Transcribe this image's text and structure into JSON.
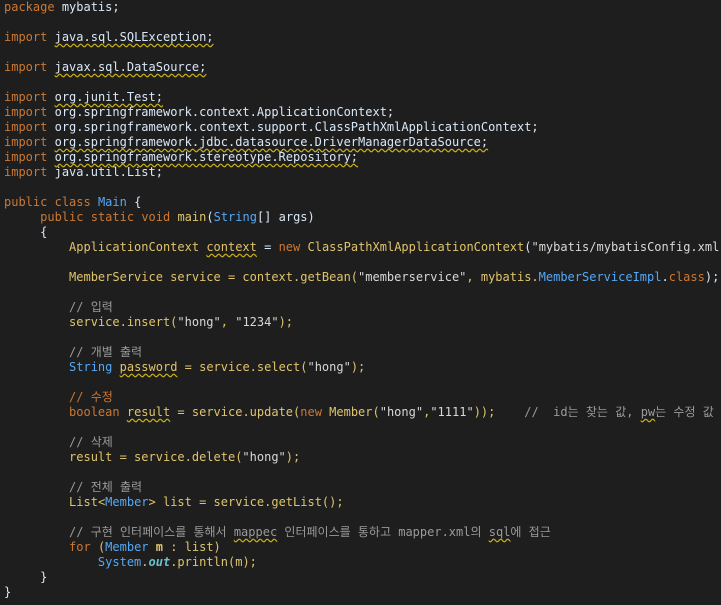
{
  "code": {
    "package_kw": "package",
    "package_name": "mybatis;",
    "import_kw": "import",
    "imports": [
      "java.sql.SQLException;",
      "javax.sql.DataSource;",
      "org.junit.Test;",
      "org.springframework.context.ApplicationContext;",
      "org.springframework.context.support.ClassPathXmlApplicationContext;",
      "org.springframework.jdbc.datasource.DriverManagerDataSource;",
      "org.springframework.stereotype.Repository;",
      "java.util.List;"
    ],
    "class_public": "public",
    "class_kw": "class",
    "class_name": "Main",
    "open_brace": "{",
    "close_brace": "}",
    "method_public": "public",
    "method_static": "static",
    "method_void": "void",
    "method_name": "main",
    "method_params_open": "(",
    "method_param_type": "String",
    "method_params_rest": "[] args)",
    "lines": {
      "ctx_type": "ApplicationContext",
      "ctx_var": "context",
      "ctx_eq": " = ",
      "ctx_new": "new",
      "ctx_cls": "ClassPathXmlApplicationContext",
      "ctx_arg_open": "(",
      "ctx_str": "\"mybatis/mybatisConfig.xml\"",
      "ctx_arg_close": ");",
      "svc_type": "MemberService",
      "svc_decl": " service = context.getBean(",
      "svc_str": "\"memberservice\"",
      "svc_mid": ", mybatis.",
      "svc_impl": "MemberServiceImpl",
      "svc_dot": ".",
      "svc_class": "class",
      "svc_end": ");",
      "c_insert": "// 입력",
      "insert_pre": "service.insert(",
      "insert_s1": "\"hong\"",
      "insert_comma": ", ",
      "insert_s2": "\"1234\"",
      "insert_end": ");",
      "c_select": "// 개별 출력",
      "sel_type": "String",
      "sel_var": "password",
      "sel_mid": " = service.select(",
      "sel_str": "\"hong\"",
      "sel_end": ");",
      "c_update": "// 수정",
      "upd_type": "boolean",
      "upd_var": "result",
      "upd_mid": " = service.update(",
      "upd_new": "new",
      "upd_cls": " Member(",
      "upd_s1": "\"hong\"",
      "upd_comma": ",",
      "upd_s2": "\"1111\"",
      "upd_end": "));",
      "upd_cmt_a": "//  id는 찾는 값, ",
      "upd_cmt_pw": "pw",
      "upd_cmt_b": "는 수정 값",
      "c_delete": "// 삭제",
      "del_pre": "result = service.delete(",
      "del_str": "\"hong\"",
      "del_end": ");",
      "c_list": "// 전체 출력",
      "list_type": "List",
      "list_lt": "<",
      "list_gen": "Member",
      "list_rest": "> list = service.getList();",
      "c_mapper_a": "// 구현 인터페이스를 통해서 ",
      "c_mapper_w1": "mappec",
      "c_mapper_b": " 인터페이스를 통하고 mapper.xml의 ",
      "c_mapper_w2": "sql",
      "c_mapper_c": "에 접근",
      "for_kw": "for",
      "for_open": " (",
      "for_type": "Member",
      "for_var": " m",
      "for_rest": " : list)",
      "sys_cls": "System",
      "sys_dot": ".",
      "sys_out": "out",
      "sys_rest": ".println(m);"
    }
  }
}
